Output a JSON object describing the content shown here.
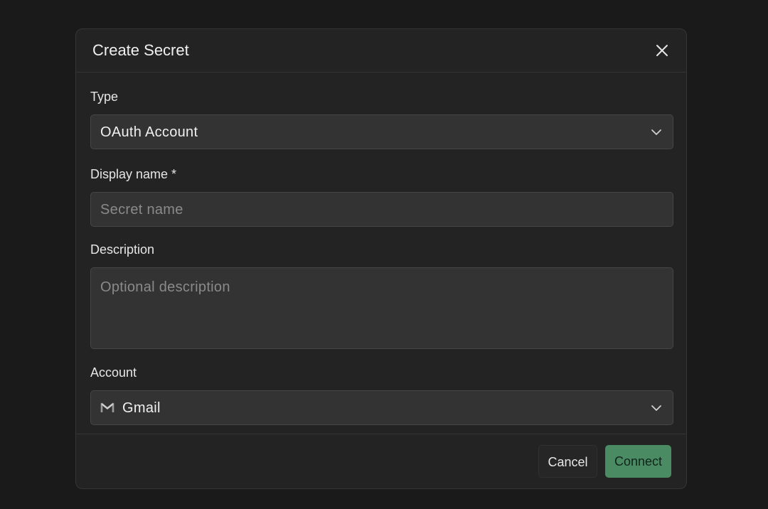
{
  "dialog": {
    "title": "Create Secret",
    "close_icon": "close-icon"
  },
  "form": {
    "type": {
      "label": "Type",
      "value": "OAuth Account",
      "icon": "chevron-down-icon"
    },
    "display_name": {
      "label": "Display name *",
      "placeholder": "Secret name",
      "value": ""
    },
    "description": {
      "label": "Description",
      "placeholder": "Optional description",
      "value": ""
    },
    "account": {
      "label": "Account",
      "value": "Gmail",
      "icon": "gmail-icon",
      "chevron": "chevron-down-icon"
    }
  },
  "footer": {
    "cancel_label": "Cancel",
    "connect_label": "Connect"
  },
  "colors": {
    "backdrop": "#1a1a1a",
    "dialog_bg": "#232323",
    "field_bg": "#333333",
    "accent": "#4b8b63"
  }
}
